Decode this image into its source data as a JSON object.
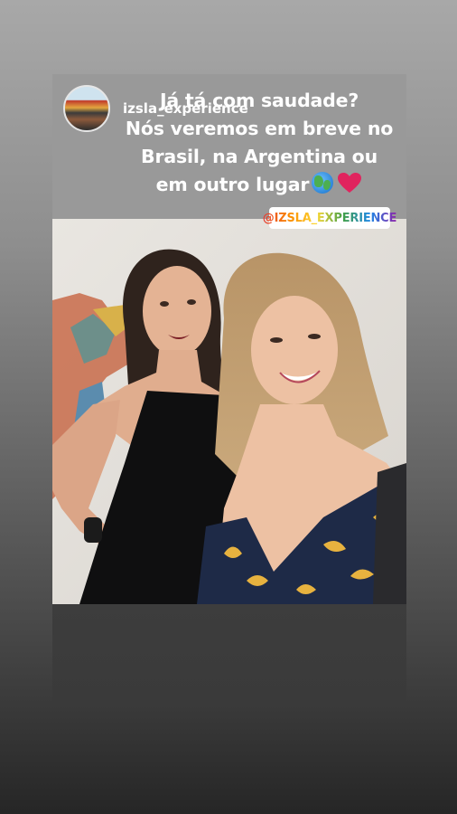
{
  "story": {
    "username": "izsla_experience",
    "caption_lines": [
      "Já tá com saudade?",
      "Nós veremos em breve no",
      "Brasil, na Argentina ou",
      "em outro lugar"
    ],
    "caption_emojis": [
      "globe-emoji",
      "red-heart-emoji"
    ],
    "mention": "@IZSLA_EXPERIENCE"
  },
  "colors": {
    "caption_bg": "#999999",
    "photo_wall": "#e4e1dc",
    "bottom_bg": "#3b3b3b",
    "heart": "#e0245e"
  }
}
